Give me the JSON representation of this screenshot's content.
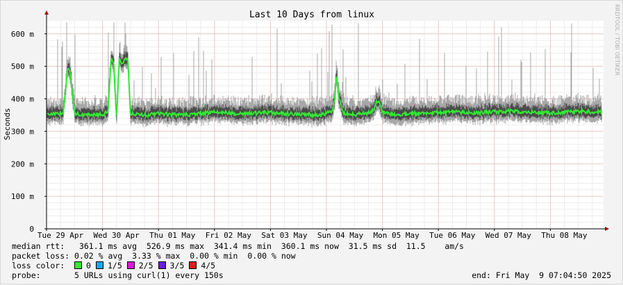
{
  "chart_data": {
    "type": "line",
    "title": "Last 10 Days from linux",
    "ylabel": "Seconds",
    "watermark": "RRDTOOL / TOBI OETIKER",
    "ylim": [
      0,
      0.64
    ],
    "y_ticks": [
      {
        "value": 0,
        "label": "0"
      },
      {
        "value": 0.1,
        "label": "100 m"
      },
      {
        "value": 0.2,
        "label": "200 m"
      },
      {
        "value": 0.3,
        "label": "300 m"
      },
      {
        "value": 0.4,
        "label": "400 m"
      },
      {
        "value": 0.5,
        "label": "500 m"
      },
      {
        "value": 0.6,
        "label": "600 m"
      }
    ],
    "x_ticks": [
      "Tue 29 Apr",
      "Wed 30 Apr",
      "Thu 01 May",
      "Fri 02 May",
      "Sat 03 May",
      "Sun 04 May",
      "Mon 05 May",
      "Tue 06 May",
      "Wed 07 May",
      "Thu 08 May"
    ],
    "x_range_days": [
      0,
      9.95
    ],
    "grid": true,
    "series": [
      {
        "name": "median rtt",
        "color": "#33e833",
        "x_days": [
          0.0,
          0.2,
          0.3,
          0.38,
          0.42,
          0.5,
          0.7,
          1.0,
          1.1,
          1.15,
          1.2,
          1.25,
          1.3,
          1.35,
          1.4,
          1.45,
          1.5,
          1.6,
          1.8,
          2.0,
          2.3,
          2.6,
          3.0,
          3.3,
          3.6,
          4.0,
          4.3,
          4.6,
          4.9,
          5.1,
          5.15,
          5.18,
          5.22,
          5.3,
          5.5,
          5.8,
          5.9,
          5.95,
          6.0,
          6.1,
          6.3,
          6.6,
          7.0,
          7.3,
          7.6,
          8.0,
          8.3,
          8.6,
          9.0,
          9.3,
          9.5,
          9.7,
          9.9
        ],
        "y": [
          0.355,
          0.352,
          0.36,
          0.5,
          0.48,
          0.355,
          0.35,
          0.352,
          0.36,
          0.52,
          0.51,
          0.34,
          0.52,
          0.51,
          0.525,
          0.52,
          0.355,
          0.352,
          0.35,
          0.355,
          0.35,
          0.352,
          0.36,
          0.356,
          0.354,
          0.358,
          0.355,
          0.352,
          0.35,
          0.36,
          0.4,
          0.48,
          0.4,
          0.356,
          0.352,
          0.358,
          0.39,
          0.39,
          0.36,
          0.355,
          0.352,
          0.355,
          0.358,
          0.36,
          0.356,
          0.36,
          0.362,
          0.358,
          0.356,
          0.36,
          0.362,
          0.36,
          0.358
        ]
      }
    ]
  },
  "stats": {
    "median": {
      "label": "median rtt:",
      "avg": "361.1 ms avg",
      "max": "526.9 ms max",
      "min": "341.4 ms min",
      "now": "360.1 ms now",
      "sd": "31.5 ms sd",
      "am": "11.5",
      "am_unit": "am/s"
    },
    "loss": {
      "label": "packet loss:",
      "avg": "0.02 % avg",
      "max": "3.33 % max",
      "min": "0.00 % min",
      "now": "0.00 % now"
    },
    "loss_color": {
      "label": "loss color:",
      "items": [
        {
          "label": "0",
          "color": "#33e833"
        },
        {
          "label": "1/5",
          "color": "#1aa7e6"
        },
        {
          "label": "2/5",
          "color": "#d21ed2"
        },
        {
          "label": "3/5",
          "color": "#6a1ae6"
        },
        {
          "label": "4/5",
          "color": "#e61a1a"
        }
      ]
    },
    "probe": {
      "label": "probe:",
      "value": "5 URLs using curl(1) every 150s"
    },
    "end": "end: Fri May  9 07:04:50 2025"
  },
  "colors": {
    "axis": "#000000",
    "grid_major": "#e4a3a3",
    "grid_minor": "#ececec",
    "band_outer": "#a8a8a8",
    "band_inner": "#4b4b4b",
    "plot_bg": "#ffffff",
    "page_bg": "#f3f3f3",
    "arrow": "#aa0000"
  }
}
